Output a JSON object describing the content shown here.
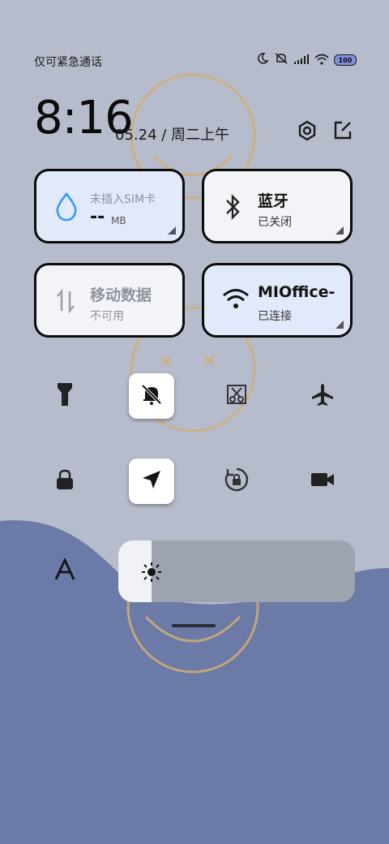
{
  "status": {
    "carrier_text": "仅可紧急通话",
    "battery": "100"
  },
  "header": {
    "time": "8:16",
    "date": "05.24 / 周二上午"
  },
  "tiles": [
    {
      "title": "未插入SIM卡",
      "value": "--",
      "unit": "MB",
      "icon": "water-drop-icon"
    },
    {
      "title": "蓝牙",
      "subtitle": "已关闭",
      "icon": "bluetooth-icon"
    },
    {
      "title": "移动数据",
      "subtitle": "不可用",
      "icon": "mobile-data-icon"
    },
    {
      "title": "MIOffice-",
      "subtitle": "已连接",
      "icon": "wifi-icon"
    }
  ],
  "brightness": {
    "level": 0.14
  },
  "colors": {
    "wave": "#6b7aa6",
    "tile_active": "#e2e9fb",
    "tile_inactive": "#f3f4f7",
    "accent": "#3b99f5"
  }
}
